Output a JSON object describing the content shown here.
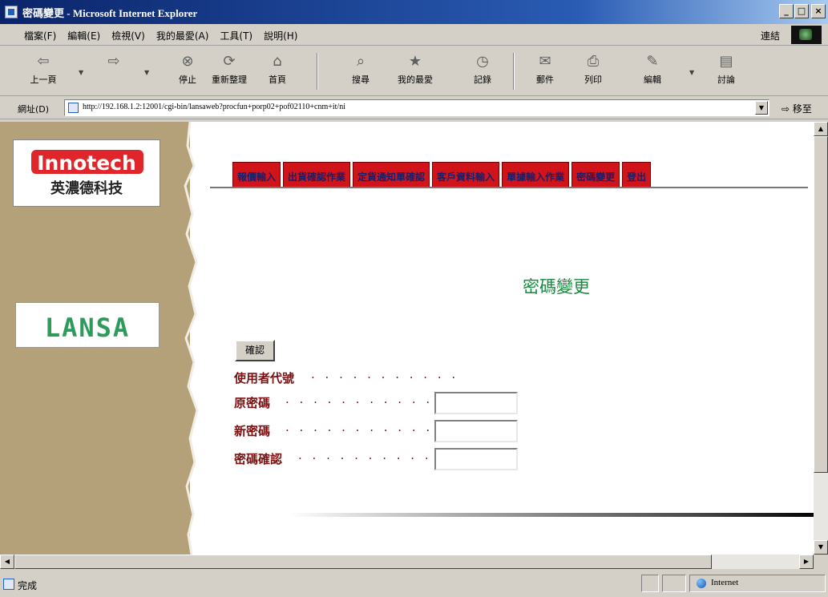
{
  "window": {
    "title": "密碼變更 - Microsoft Internet Explorer",
    "controls": {
      "minimize": "_",
      "maximize": "□",
      "close": "×"
    }
  },
  "menubar": {
    "items": [
      "檔案(F)",
      "編輯(E)",
      "檢視(V)",
      "我的最愛(A)",
      "工具(T)",
      "說明(H)"
    ],
    "links_label": "連結"
  },
  "toolbar": {
    "buttons": [
      {
        "label": "上一頁",
        "icon": "back-arrow-icon"
      },
      {
        "label": "",
        "icon": "forward-arrow-icon"
      },
      {
        "label": "停止",
        "icon": "stop-icon"
      },
      {
        "label": "重新整理",
        "icon": "refresh-icon"
      },
      {
        "label": "首頁",
        "icon": "home-icon"
      },
      {
        "label": "搜尋",
        "icon": "search-icon"
      },
      {
        "label": "我的最愛",
        "icon": "favorites-icon"
      },
      {
        "label": "記錄",
        "icon": "history-icon"
      },
      {
        "label": "郵件",
        "icon": "mail-icon"
      },
      {
        "label": "列印",
        "icon": "print-icon"
      },
      {
        "label": "編輯",
        "icon": "edit-icon"
      },
      {
        "label": "討論",
        "icon": "discuss-icon"
      }
    ]
  },
  "address": {
    "label": "網址(D)",
    "url": "http://192.168.1.2:12001/cgi-bin/lansaweb?procfun+porp02+pof02110+cnm+it/ni",
    "go_label": "移至"
  },
  "sidebar": {
    "logo1_name": "Innotech",
    "logo1_sub": "英濃德科技",
    "logo2_name": "LANSA"
  },
  "nav": {
    "tabs": [
      "報價輸入",
      "出貨確認作業",
      "定貨通知單確認",
      "客戶資料輸入",
      "單據輸入作業",
      "密碼變更",
      "登出"
    ]
  },
  "page": {
    "heading": "密碼變更",
    "confirm_label": "確認",
    "fields": [
      {
        "label": "使用者代號",
        "dots": ". . . . . . . . . . .",
        "value": ""
      },
      {
        "label": "原密碼",
        "dots": ". . . . . . . . . . . . .",
        "value": ""
      },
      {
        "label": "新密碼",
        "dots": ". . . . . . . . . . . . .",
        "value": ""
      },
      {
        "label": "密碼確認",
        "dots": ". . . . . . . . . . .",
        "value": ""
      }
    ]
  },
  "status": {
    "text": "完成",
    "zone": "Internet"
  }
}
